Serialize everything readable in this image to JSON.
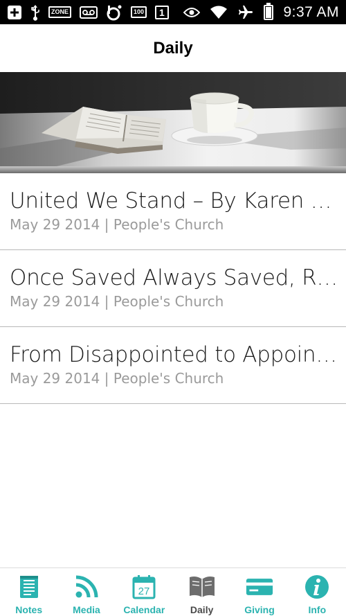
{
  "status_bar": {
    "time": "9:37 AM",
    "icons": [
      "add-box-icon",
      "usb-icon",
      "zone-icon",
      "voicemail-icon",
      "beats-icon",
      "storage-100-icon",
      "sim-1-icon",
      "eye-icon",
      "wifi-icon",
      "airplane-icon",
      "battery-icon"
    ],
    "zone_label": "ZONE",
    "storage_label": "100",
    "sim_label": "1"
  },
  "header": {
    "title": "Daily"
  },
  "hero": {
    "image": "bible-and-coffee-cup-photo"
  },
  "items": [
    {
      "title": "United We Stand – By Karen Kr…",
      "subtitle": "May 29 2014 | People's Church"
    },
    {
      "title": "Once Saved Always Saved, Right?",
      "subtitle": "May 29 2014 | People's Church"
    },
    {
      "title": "From Disappointed to Appointed",
      "subtitle": "May 29 2014 | People's Church"
    }
  ],
  "tabs": [
    {
      "label": "Notes",
      "icon": "notes-icon"
    },
    {
      "label": "Media",
      "icon": "rss-icon"
    },
    {
      "label": "Calendar",
      "icon": "calendar-icon",
      "badge": "27"
    },
    {
      "label": "Daily",
      "icon": "book-icon",
      "active": true
    },
    {
      "label": "Giving",
      "icon": "credit-card-icon"
    },
    {
      "label": "Info",
      "icon": "info-icon"
    }
  ],
  "colors": {
    "accent": "#2bb3b0",
    "active_tab": "#4a4a4a",
    "subtitle": "#9a9a9a",
    "status_bar": "#000000"
  }
}
